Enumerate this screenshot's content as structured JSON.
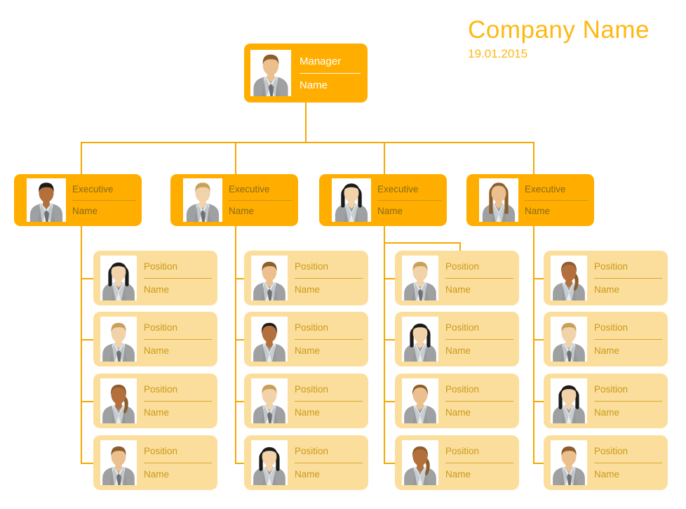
{
  "header": {
    "company": "Company Name",
    "date": "19.01.2015"
  },
  "colors": {
    "accent_orange": "#FFAE00",
    "line_orange": "#F5A800",
    "title_gold": "#FDB913",
    "card_cream": "#FCDE9C",
    "card_text_gold": "#C99A1B",
    "exec_text": "#8A6A14",
    "manager_text": "#FFFFFF"
  },
  "manager": {
    "role": "Manager",
    "name": "Name",
    "avatar": "male-brown-hair-suit-tie"
  },
  "executives": [
    {
      "role": "Executive",
      "name": "Name",
      "avatar": "male-dark-skin-black-hair-suit-tie"
    },
    {
      "role": "Executive",
      "name": "Name",
      "avatar": "male-blond-hair-suit-tie"
    },
    {
      "role": "Executive",
      "name": "Name",
      "avatar": "female-black-bob-blazer"
    },
    {
      "role": "Executive",
      "name": "Name",
      "avatar": "female-long-brown-hair-blazer"
    }
  ],
  "columns": [
    {
      "positions": [
        {
          "role": "Position",
          "name": "Name",
          "avatar": "female-black-bob-blazer"
        },
        {
          "role": "Position",
          "name": "Name",
          "avatar": "male-blond-hair-suit-tie"
        },
        {
          "role": "Position",
          "name": "Name",
          "avatar": "female-dark-skin-ponytail-blazer"
        },
        {
          "role": "Position",
          "name": "Name",
          "avatar": "male-brown-hair-suit-tie"
        }
      ]
    },
    {
      "positions": [
        {
          "role": "Position",
          "name": "Name",
          "avatar": "male-brown-hair-suit-tie"
        },
        {
          "role": "Position",
          "name": "Name",
          "avatar": "female-dark-skin-black-hair-blazer"
        },
        {
          "role": "Position",
          "name": "Name",
          "avatar": "male-blond-hair-suit-tie"
        },
        {
          "role": "Position",
          "name": "Name",
          "avatar": "female-black-bob-blazer"
        }
      ]
    },
    {
      "positions": [
        {
          "role": "Position",
          "name": "Name",
          "avatar": "male-blond-hair-suit-tie"
        },
        {
          "role": "Position",
          "name": "Name",
          "avatar": "female-black-bob-blazer"
        },
        {
          "role": "Position",
          "name": "Name",
          "avatar": "female-brown-hair-blazer"
        },
        {
          "role": "Position",
          "name": "Name",
          "avatar": "female-dark-skin-ponytail-blazer"
        }
      ]
    },
    {
      "positions": [
        {
          "role": "Position",
          "name": "Name",
          "avatar": "female-dark-skin-ponytail-blazer"
        },
        {
          "role": "Position",
          "name": "Name",
          "avatar": "male-blond-hair-suit-tie"
        },
        {
          "role": "Position",
          "name": "Name",
          "avatar": "female-black-bob-blazer"
        },
        {
          "role": "Position",
          "name": "Name",
          "avatar": "male-brown-hair-suit-tie"
        }
      ]
    }
  ]
}
